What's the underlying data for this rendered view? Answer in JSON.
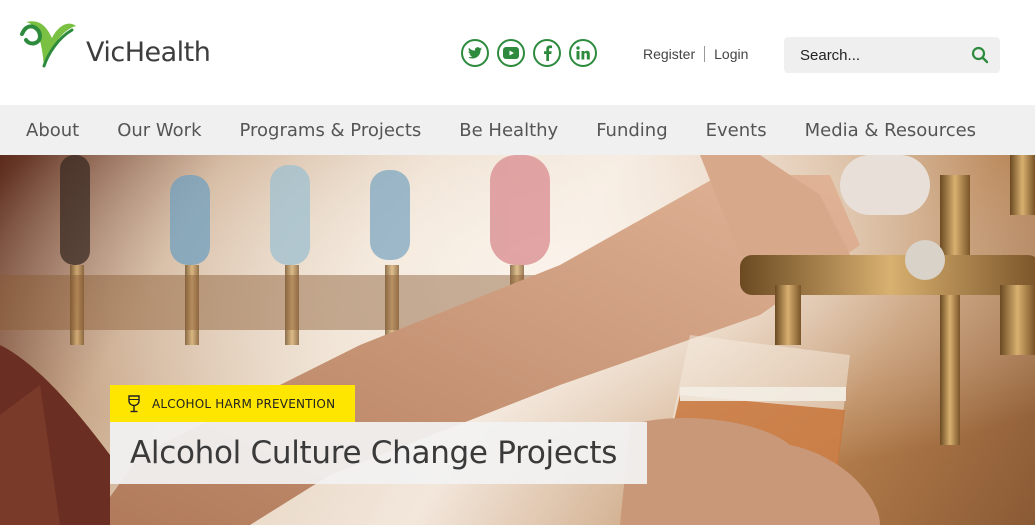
{
  "brand": {
    "name": "VicHealth",
    "green": "#7ac143",
    "dark_green": "#2e8b3e"
  },
  "social": [
    {
      "name": "twitter-icon",
      "glyph": "t"
    },
    {
      "name": "youtube-icon",
      "glyph": "▶"
    },
    {
      "name": "facebook-icon",
      "glyph": "f"
    },
    {
      "name": "linkedin-icon",
      "glyph": "in"
    }
  ],
  "auth": {
    "register": "Register",
    "login": "Login"
  },
  "search": {
    "placeholder": "Search..."
  },
  "nav": [
    {
      "label": "About"
    },
    {
      "label": "Our Work"
    },
    {
      "label": "Programs & Projects"
    },
    {
      "label": "Be Healthy"
    },
    {
      "label": "Funding"
    },
    {
      "label": "Events"
    },
    {
      "label": "Media & Resources"
    }
  ],
  "hero": {
    "category": "ALCOHOL HARM PREVENTION",
    "category_icon": "wine-glass-icon",
    "title": "Alcohol Culture Change Projects",
    "tag_color": "#ffe600"
  }
}
